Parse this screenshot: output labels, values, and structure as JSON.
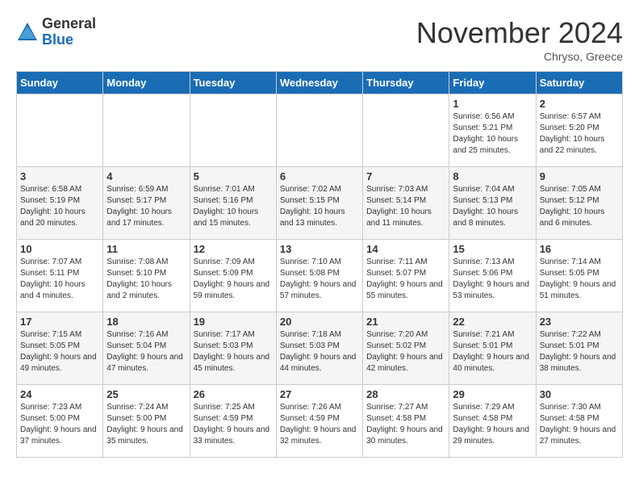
{
  "header": {
    "logo_general": "General",
    "logo_blue": "Blue",
    "month_title": "November 2024",
    "location": "Chryso, Greece"
  },
  "weekdays": [
    "Sunday",
    "Monday",
    "Tuesday",
    "Wednesday",
    "Thursday",
    "Friday",
    "Saturday"
  ],
  "weeks": [
    [
      {
        "day": "",
        "info": ""
      },
      {
        "day": "",
        "info": ""
      },
      {
        "day": "",
        "info": ""
      },
      {
        "day": "",
        "info": ""
      },
      {
        "day": "",
        "info": ""
      },
      {
        "day": "1",
        "info": "Sunrise: 6:56 AM\nSunset: 5:21 PM\nDaylight: 10 hours and 25 minutes."
      },
      {
        "day": "2",
        "info": "Sunrise: 6:57 AM\nSunset: 5:20 PM\nDaylight: 10 hours and 22 minutes."
      }
    ],
    [
      {
        "day": "3",
        "info": "Sunrise: 6:58 AM\nSunset: 5:19 PM\nDaylight: 10 hours and 20 minutes."
      },
      {
        "day": "4",
        "info": "Sunrise: 6:59 AM\nSunset: 5:17 PM\nDaylight: 10 hours and 17 minutes."
      },
      {
        "day": "5",
        "info": "Sunrise: 7:01 AM\nSunset: 5:16 PM\nDaylight: 10 hours and 15 minutes."
      },
      {
        "day": "6",
        "info": "Sunrise: 7:02 AM\nSunset: 5:15 PM\nDaylight: 10 hours and 13 minutes."
      },
      {
        "day": "7",
        "info": "Sunrise: 7:03 AM\nSunset: 5:14 PM\nDaylight: 10 hours and 11 minutes."
      },
      {
        "day": "8",
        "info": "Sunrise: 7:04 AM\nSunset: 5:13 PM\nDaylight: 10 hours and 8 minutes."
      },
      {
        "day": "9",
        "info": "Sunrise: 7:05 AM\nSunset: 5:12 PM\nDaylight: 10 hours and 6 minutes."
      }
    ],
    [
      {
        "day": "10",
        "info": "Sunrise: 7:07 AM\nSunset: 5:11 PM\nDaylight: 10 hours and 4 minutes."
      },
      {
        "day": "11",
        "info": "Sunrise: 7:08 AM\nSunset: 5:10 PM\nDaylight: 10 hours and 2 minutes."
      },
      {
        "day": "12",
        "info": "Sunrise: 7:09 AM\nSunset: 5:09 PM\nDaylight: 9 hours and 59 minutes."
      },
      {
        "day": "13",
        "info": "Sunrise: 7:10 AM\nSunset: 5:08 PM\nDaylight: 9 hours and 57 minutes."
      },
      {
        "day": "14",
        "info": "Sunrise: 7:11 AM\nSunset: 5:07 PM\nDaylight: 9 hours and 55 minutes."
      },
      {
        "day": "15",
        "info": "Sunrise: 7:13 AM\nSunset: 5:06 PM\nDaylight: 9 hours and 53 minutes."
      },
      {
        "day": "16",
        "info": "Sunrise: 7:14 AM\nSunset: 5:05 PM\nDaylight: 9 hours and 51 minutes."
      }
    ],
    [
      {
        "day": "17",
        "info": "Sunrise: 7:15 AM\nSunset: 5:05 PM\nDaylight: 9 hours and 49 minutes."
      },
      {
        "day": "18",
        "info": "Sunrise: 7:16 AM\nSunset: 5:04 PM\nDaylight: 9 hours and 47 minutes."
      },
      {
        "day": "19",
        "info": "Sunrise: 7:17 AM\nSunset: 5:03 PM\nDaylight: 9 hours and 45 minutes."
      },
      {
        "day": "20",
        "info": "Sunrise: 7:18 AM\nSunset: 5:03 PM\nDaylight: 9 hours and 44 minutes."
      },
      {
        "day": "21",
        "info": "Sunrise: 7:20 AM\nSunset: 5:02 PM\nDaylight: 9 hours and 42 minutes."
      },
      {
        "day": "22",
        "info": "Sunrise: 7:21 AM\nSunset: 5:01 PM\nDaylight: 9 hours and 40 minutes."
      },
      {
        "day": "23",
        "info": "Sunrise: 7:22 AM\nSunset: 5:01 PM\nDaylight: 9 hours and 38 minutes."
      }
    ],
    [
      {
        "day": "24",
        "info": "Sunrise: 7:23 AM\nSunset: 5:00 PM\nDaylight: 9 hours and 37 minutes."
      },
      {
        "day": "25",
        "info": "Sunrise: 7:24 AM\nSunset: 5:00 PM\nDaylight: 9 hours and 35 minutes."
      },
      {
        "day": "26",
        "info": "Sunrise: 7:25 AM\nSunset: 4:59 PM\nDaylight: 9 hours and 33 minutes."
      },
      {
        "day": "27",
        "info": "Sunrise: 7:26 AM\nSunset: 4:59 PM\nDaylight: 9 hours and 32 minutes."
      },
      {
        "day": "28",
        "info": "Sunrise: 7:27 AM\nSunset: 4:58 PM\nDaylight: 9 hours and 30 minutes."
      },
      {
        "day": "29",
        "info": "Sunrise: 7:29 AM\nSunset: 4:58 PM\nDaylight: 9 hours and 29 minutes."
      },
      {
        "day": "30",
        "info": "Sunrise: 7:30 AM\nSunset: 4:58 PM\nDaylight: 9 hours and 27 minutes."
      }
    ]
  ]
}
